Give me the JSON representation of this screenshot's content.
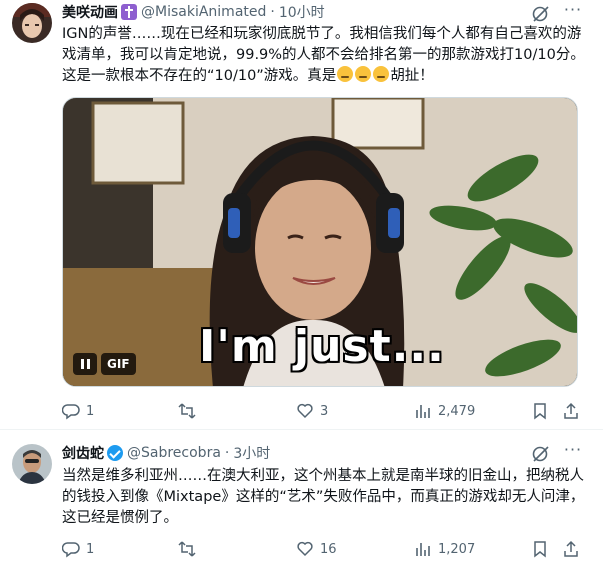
{
  "posts": [
    {
      "author": {
        "name": "美咲动画",
        "handle": "@MisakiAnimated",
        "time": "10小时",
        "badge": "cross-badge-icon"
      },
      "text": "IGN的声誉……现在已经和玩家彻底脱节了。我相信我们每个人都有自己喜欢的游戏清单，我可以肯定地说，99.9%的人都不会给排名第一的那款游戏打10/10分。这是一款根本不存在的“10/10”游戏。真是",
      "text_tail": "胡扯！",
      "media": {
        "type": "GIF",
        "label": "GIF",
        "caption": "I'm just..."
      },
      "stats": {
        "replies": "1",
        "reposts": "",
        "likes": "3",
        "views": "2,479"
      }
    },
    {
      "author": {
        "name": "剑齿蛇",
        "handle": "@Sabrecobra",
        "time": "3小时",
        "badge": "verified-badge-icon"
      },
      "text": "当然是维多利亚州……在澳大利亚，这个州基本上就是南半球的旧金山，把纳税人的钱投入到像《Mixtape》这样的“艺术”失败作品中，而真正的游戏却无人问津，这已经是惯例了。",
      "stats": {
        "replies": "1",
        "reposts": "",
        "likes": "16",
        "views": "1,207"
      }
    }
  ],
  "separator": "·",
  "colors": {
    "text": "#0f1419",
    "muted": "#536471",
    "verified": "#1d9bf0",
    "cross_badge": "#8e5fcf",
    "divider": "#eff3f4"
  }
}
